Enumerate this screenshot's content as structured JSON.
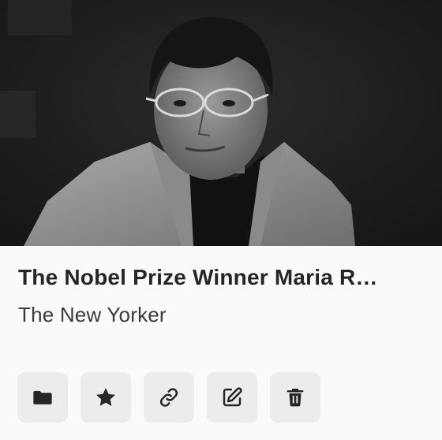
{
  "card": {
    "image_alt": "Black and white portrait of Maria Ressa",
    "title": "The Nobel Prize Winner Maria R…",
    "source": "The New Yorker"
  },
  "actions": [
    {
      "icon": "folder-icon",
      "label": "Move to folder"
    },
    {
      "icon": "star-icon",
      "label": "Favorite"
    },
    {
      "icon": "link-icon",
      "label": "Copy link"
    },
    {
      "icon": "edit-icon",
      "label": "Edit"
    },
    {
      "icon": "trash-icon",
      "label": "Delete"
    }
  ],
  "colors": {
    "background": "#fafafa",
    "button_bg": "#ececec",
    "icon": "#262626",
    "title": "#262626"
  }
}
